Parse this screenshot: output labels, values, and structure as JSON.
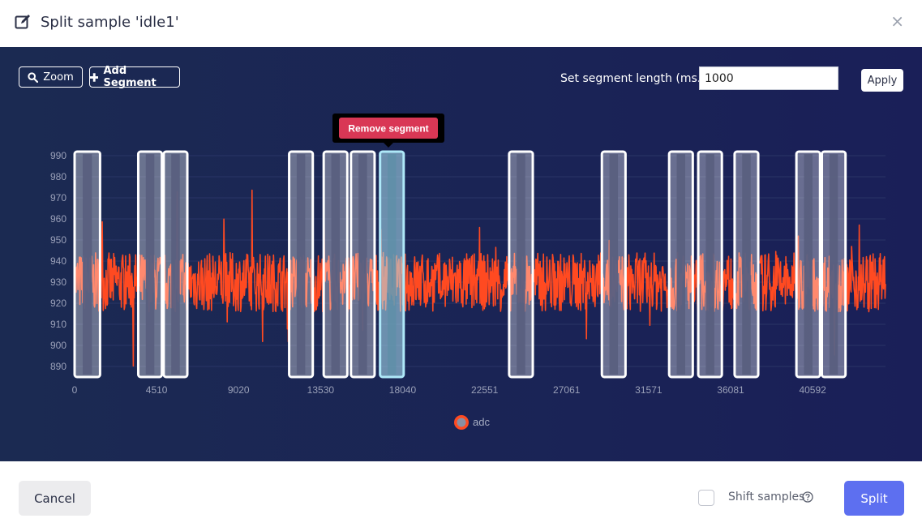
{
  "header": {
    "title": "Split sample 'idle1'",
    "close_label": "×"
  },
  "toolbar": {
    "zoom_label": "Zoom",
    "add_segment_label": "Add Segment"
  },
  "segment_length": {
    "label": "Set segment length (ms.):",
    "value": "1000",
    "apply_label": "Apply"
  },
  "tooltip": {
    "remove_label": "Remove segment"
  },
  "footer": {
    "cancel_label": "Cancel",
    "shift_label": "Shift samples",
    "split_label": "Split"
  },
  "colors": {
    "series": "#ff4a21",
    "selected_segment": "#aee8f8",
    "split_button": "#5d6ff0",
    "remove_button": "#d93755"
  },
  "chart_data": {
    "type": "line",
    "x_ticks": [
      0,
      4510,
      9020,
      13530,
      18040,
      22551,
      27061,
      31571,
      36081,
      40592
    ],
    "y_ticks": [
      890,
      900,
      910,
      920,
      930,
      940,
      950,
      960,
      970,
      980,
      990
    ],
    "x_range": [
      0,
      44600
    ],
    "y_range": [
      885,
      995
    ],
    "legend": [
      "adc"
    ],
    "legend_position": "bottom-center",
    "segments": [
      {
        "start": 0,
        "end": 1400
      },
      {
        "start": 3500,
        "end": 4800
      },
      {
        "start": 4900,
        "end": 6200
      },
      {
        "start": 11800,
        "end": 13100
      },
      {
        "start": 13700,
        "end": 15000
      },
      {
        "start": 15200,
        "end": 16500
      },
      {
        "start": 16800,
        "end": 18100,
        "selected": true
      },
      {
        "start": 23900,
        "end": 25200
      },
      {
        "start": 29000,
        "end": 30300
      },
      {
        "start": 32700,
        "end": 34000
      },
      {
        "start": 34300,
        "end": 35600
      },
      {
        "start": 36300,
        "end": 37600
      },
      {
        "start": 39700,
        "end": 41000
      },
      {
        "start": 41100,
        "end": 42400
      }
    ]
  }
}
